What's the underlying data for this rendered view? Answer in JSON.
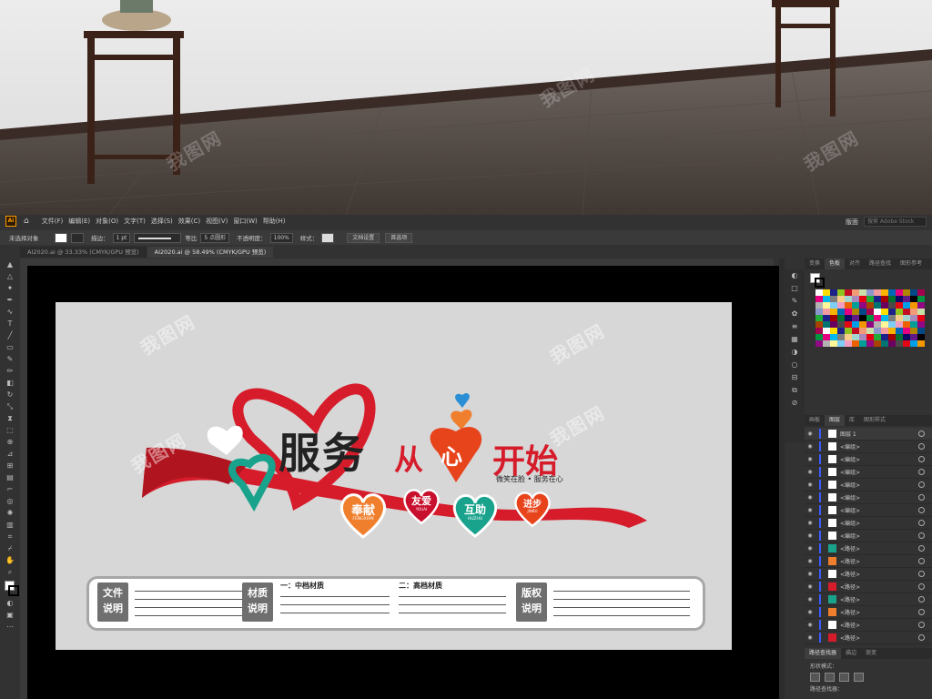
{
  "menubar": {
    "logo": "Ai",
    "home": "⌂",
    "items": [
      "文件(F)",
      "编辑(E)",
      "对象(O)",
      "文字(T)",
      "选择(S)",
      "效果(C)",
      "视图(V)",
      "窗口(W)",
      "帮助(H)"
    ],
    "workspace": "版面",
    "search_placeholder": "搜索 Adobe Stock"
  },
  "control_bar": {
    "selection": "未选择对象",
    "stroke_label": "描边：",
    "stroke_value": "1 pt",
    "profile": "等比",
    "brush": "5 点圆形",
    "opacity_label": "不透明度：",
    "opacity_value": "100%",
    "style_label": "样式：",
    "doc_settings": "文档设置",
    "preferences": "首选项"
  },
  "doc_tabs": [
    {
      "label": "AI2020.ai @ 33.33% (CMYK/GPU 预览)",
      "active": false
    },
    {
      "label": "AI2020.ai @ 58.49% (CMYK/GPU 预览)",
      "active": true
    }
  ],
  "right_panel": {
    "top_tabs": [
      "变换",
      "色板",
      "对齐",
      "路径查找",
      "图形参考"
    ],
    "layer_tabs": [
      "画板",
      "图层",
      "库",
      "图形样式"
    ],
    "layers": [
      {
        "name": "图层 1",
        "top": true
      },
      {
        "name": "<编组>"
      },
      {
        "name": "<编组>"
      },
      {
        "name": "<编组>"
      },
      {
        "name": "<编组>"
      },
      {
        "name": "<编组>"
      },
      {
        "name": "<编组>"
      },
      {
        "name": "<编组>"
      },
      {
        "name": "<编组>"
      },
      {
        "name": "<路径>"
      },
      {
        "name": "<路径>"
      },
      {
        "name": "<路径>"
      },
      {
        "name": "<路径>"
      },
      {
        "name": "<路径>"
      },
      {
        "name": "<路径>"
      },
      {
        "name": "<路径>"
      },
      {
        "name": "<路径>"
      }
    ],
    "pathfinder_tabs": [
      "路径查找器",
      "描边",
      "渐变"
    ],
    "shape_mode": "形状模式：",
    "pathfinder_label": "路径查找器："
  },
  "design": {
    "title_main": "服务",
    "title_from": "从",
    "title_heart": "心",
    "title_start": "开始",
    "subtitle": "微笑在脸 • 服务在心",
    "hearts": [
      {
        "cn": "奉献",
        "py": "FENGXIAN",
        "color": "#f07f2d"
      },
      {
        "cn": "友爱",
        "py": "YOUAI",
        "color": "#c8102e"
      },
      {
        "cn": "互助",
        "py": "HUZHU",
        "color": "#1aa38c"
      },
      {
        "cn": "进步",
        "py": "JINBU",
        "color": "#e8441c"
      }
    ],
    "info_labels": [
      "文件\n说明",
      "材质\n说明",
      "版权\n说明"
    ],
    "col_titles": [
      "一：中档材质",
      "二：高档材质"
    ],
    "watermark": "我图网"
  },
  "colors": {
    "red": "#d61c2a",
    "orange": "#f07f2d",
    "teal": "#1aa38c",
    "blue": "#2b8fd6",
    "panel_bg": "#323232"
  }
}
